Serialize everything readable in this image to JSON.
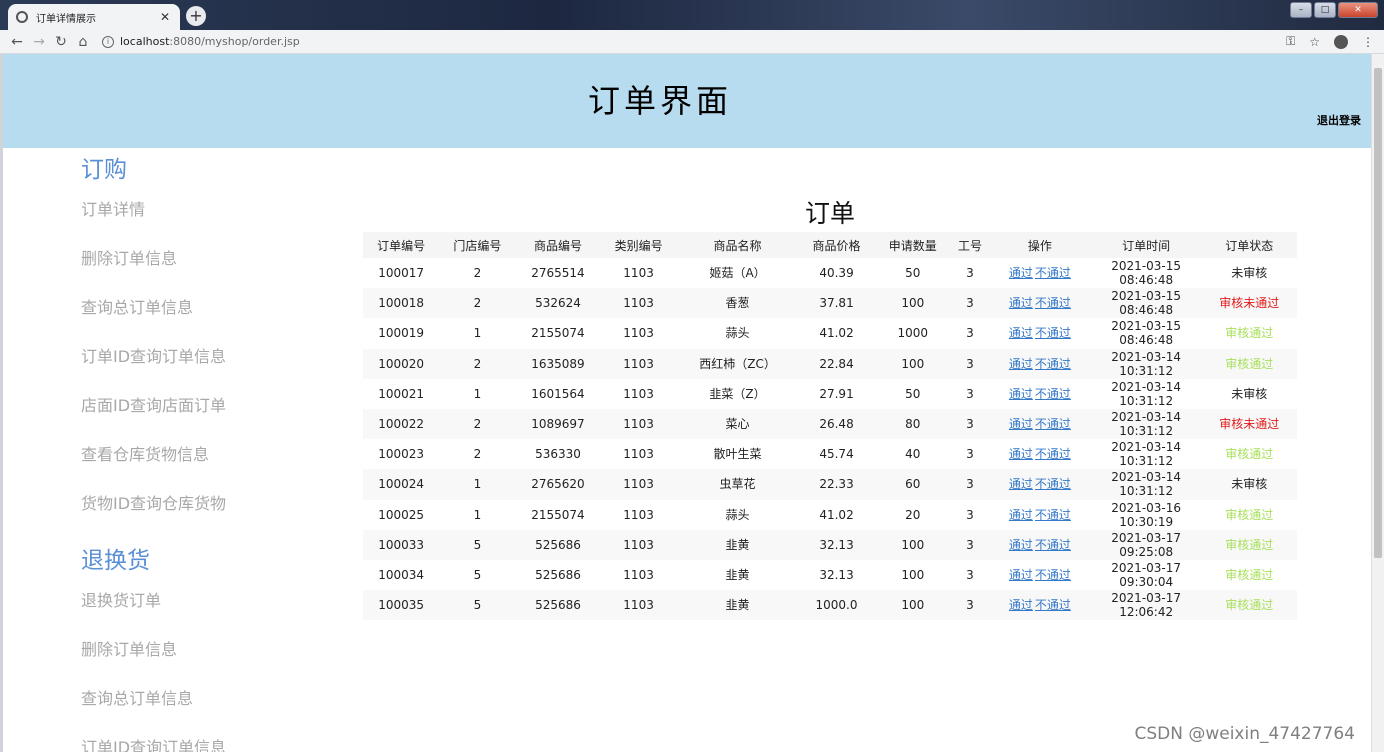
{
  "browser": {
    "tab_title": "订单详情展示",
    "tab_close": "✕",
    "new_tab": "+",
    "url_host": "localhost",
    "url_path": ":8080/myshop/order.jsp",
    "win_minimize": "–",
    "win_maximize": "□",
    "win_close": "✕",
    "back": "←",
    "forward": "→",
    "reload": "↻",
    "home": "⌂",
    "key_icon": "⚿",
    "star_icon": "☆",
    "menu_icon": "⋮"
  },
  "header": {
    "title": "订单界面",
    "logout": "退出登录",
    "bg_color": "#b8dcef"
  },
  "sidebar": {
    "sections": [
      {
        "heading": "订购",
        "items": [
          "订单详情",
          "删除订单信息",
          "查询总订单信息",
          "订单ID查询订单信息",
          "店面ID查询店面订单",
          "查看仓库货物信息",
          "货物ID查询仓库货物"
        ]
      },
      {
        "heading": "退换货",
        "items": [
          "退换货订单",
          "删除订单信息",
          "查询总订单信息",
          "订单ID查询订单信息"
        ]
      }
    ]
  },
  "main": {
    "title": "订单",
    "columns": [
      "订单编号",
      "门店编号",
      "商品编号",
      "类别编号",
      "商品名称",
      "商品价格",
      "申请数量",
      "工号",
      "操作",
      "订单时间",
      "订单状态"
    ],
    "op_pass": "通过",
    "op_reject": "不通过",
    "rows": [
      {
        "id": "100017",
        "store": "2",
        "goods": "2765514",
        "cat": "1103",
        "name": "姬菇（A）",
        "price": "40.39",
        "qty": "50",
        "staff": "3",
        "date": "2021-03-15",
        "time": "08:46:48",
        "status": "未审核",
        "status_type": "pending"
      },
      {
        "id": "100018",
        "store": "2",
        "goods": "532624",
        "cat": "1103",
        "name": "香葱",
        "price": "37.81",
        "qty": "100",
        "staff": "3",
        "date": "2021-03-15",
        "time": "08:46:48",
        "status": "审核未通过",
        "status_type": "fail"
      },
      {
        "id": "100019",
        "store": "1",
        "goods": "2155074",
        "cat": "1103",
        "name": "蒜头",
        "price": "41.02",
        "qty": "1000",
        "staff": "3",
        "date": "2021-03-15",
        "time": "08:46:48",
        "status": "审核通过",
        "status_type": "pass"
      },
      {
        "id": "100020",
        "store": "2",
        "goods": "1635089",
        "cat": "1103",
        "name": "西红柿（ZC）",
        "price": "22.84",
        "qty": "100",
        "staff": "3",
        "date": "2021-03-14",
        "time": "10:31:12",
        "status": "审核通过",
        "status_type": "pass"
      },
      {
        "id": "100021",
        "store": "1",
        "goods": "1601564",
        "cat": "1103",
        "name": "韭菜（Z）",
        "price": "27.91",
        "qty": "50",
        "staff": "3",
        "date": "2021-03-14",
        "time": "10:31:12",
        "status": "未审核",
        "status_type": "pending"
      },
      {
        "id": "100022",
        "store": "2",
        "goods": "1089697",
        "cat": "1103",
        "name": "菜心",
        "price": "26.48",
        "qty": "80",
        "staff": "3",
        "date": "2021-03-14",
        "time": "10:31:12",
        "status": "审核未通过",
        "status_type": "fail"
      },
      {
        "id": "100023",
        "store": "2",
        "goods": "536330",
        "cat": "1103",
        "name": "散叶生菜",
        "price": "45.74",
        "qty": "40",
        "staff": "3",
        "date": "2021-03-14",
        "time": "10:31:12",
        "status": "审核通过",
        "status_type": "pass"
      },
      {
        "id": "100024",
        "store": "1",
        "goods": "2765620",
        "cat": "1103",
        "name": "虫草花",
        "price": "22.33",
        "qty": "60",
        "staff": "3",
        "date": "2021-03-14",
        "time": "10:31:12",
        "status": "未审核",
        "status_type": "pending"
      },
      {
        "id": "100025",
        "store": "1",
        "goods": "2155074",
        "cat": "1103",
        "name": "蒜头",
        "price": "41.02",
        "qty": "20",
        "staff": "3",
        "date": "2021-03-16",
        "time": "10:30:19",
        "status": "审核通过",
        "status_type": "pass"
      },
      {
        "id": "100033",
        "store": "5",
        "goods": "525686",
        "cat": "1103",
        "name": "韭黄",
        "price": "32.13",
        "qty": "100",
        "staff": "3",
        "date": "2021-03-17",
        "time": "09:25:08",
        "status": "审核通过",
        "status_type": "pass"
      },
      {
        "id": "100034",
        "store": "5",
        "goods": "525686",
        "cat": "1103",
        "name": "韭黄",
        "price": "32.13",
        "qty": "100",
        "staff": "3",
        "date": "2021-03-17",
        "time": "09:30:04",
        "status": "审核通过",
        "status_type": "pass"
      },
      {
        "id": "100035",
        "store": "5",
        "goods": "525686",
        "cat": "1103",
        "name": "韭黄",
        "price": "1000.0",
        "qty": "100",
        "staff": "3",
        "date": "2021-03-17",
        "time": "12:06:42",
        "status": "审核通过",
        "status_type": "pass"
      }
    ]
  },
  "watermark": "CSDN @weixin_47427764"
}
